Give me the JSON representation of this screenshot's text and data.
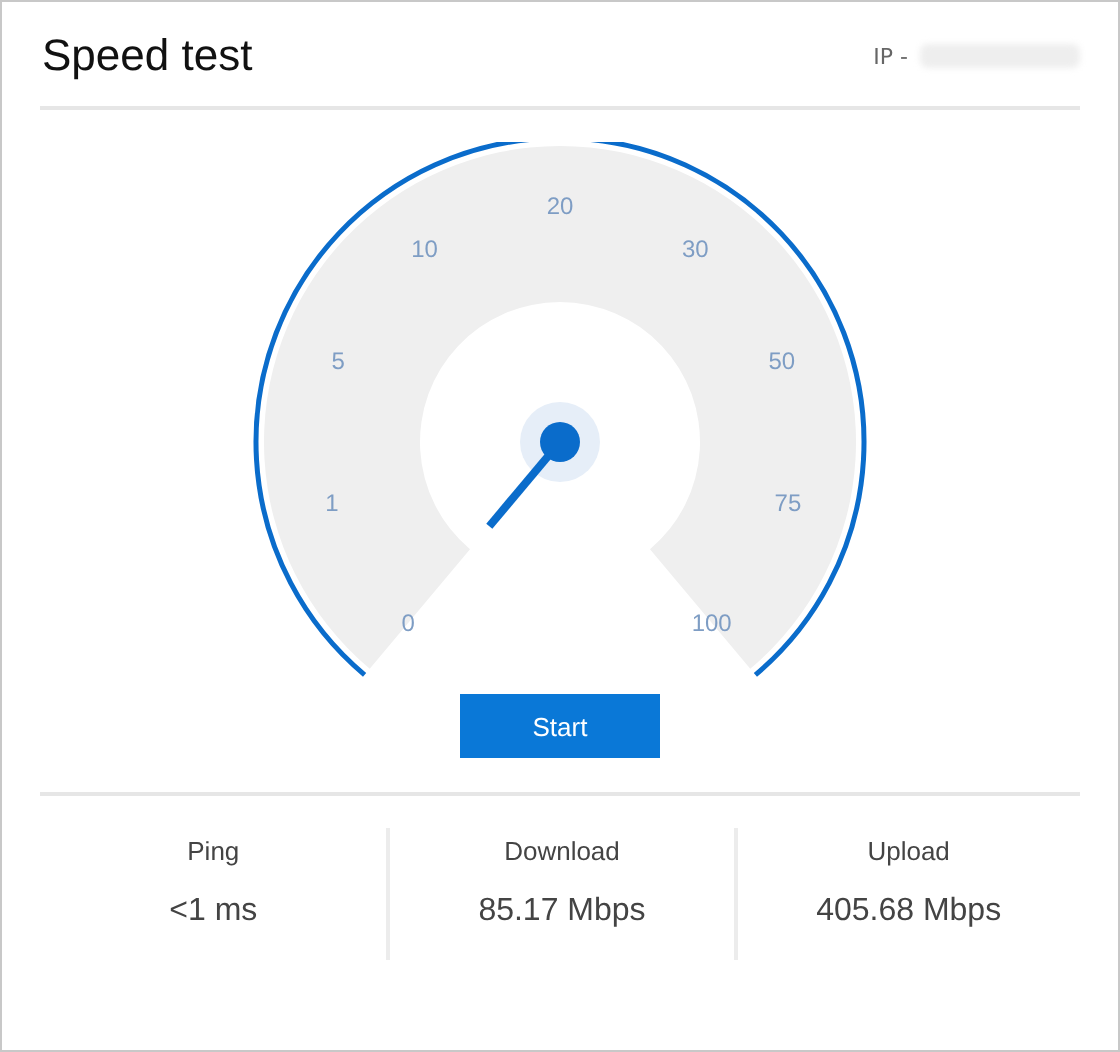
{
  "header": {
    "title": "Speed test",
    "ip_label": "IP -"
  },
  "gauge": {
    "ticks": [
      "0",
      "1",
      "5",
      "10",
      "20",
      "30",
      "50",
      "75",
      "100"
    ]
  },
  "start_button": "Start",
  "stats": [
    {
      "label": "Ping",
      "value": "<1 ms"
    },
    {
      "label": "Download",
      "value": "85.17 Mbps"
    },
    {
      "label": "Upload",
      "value": "405.68 Mbps"
    }
  ]
}
